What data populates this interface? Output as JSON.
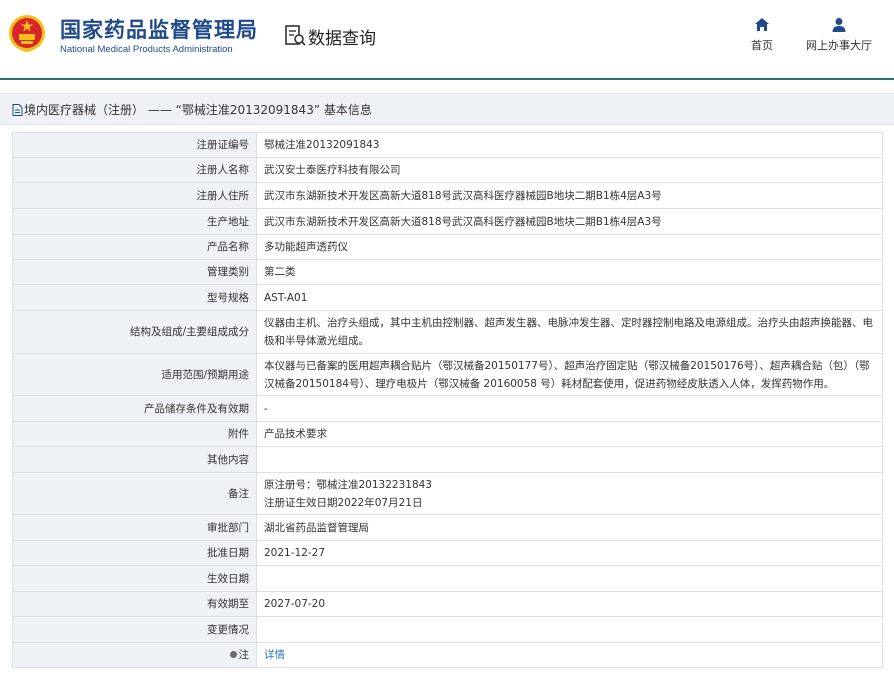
{
  "header": {
    "logo_cn": "国家药品监督管理局",
    "logo_en": "National Medical Products Administration",
    "site_title": "数据查询",
    "nav": [
      {
        "label": "首页",
        "icon": "home-icon"
      },
      {
        "label": "网上办事大厅",
        "icon": "person-icon"
      }
    ]
  },
  "breadcrumb": "境内医疗器械（注册） —— “鄂械注准20132091843” 基本信息",
  "colors": {
    "brand": "#1e4a8c",
    "header_line": "#2a6f7a",
    "label_bg": "#eef1f5",
    "link": "#3a78c2",
    "emblem_red": "#d8262c",
    "emblem_gold": "#f3c018"
  },
  "rows": [
    {
      "label": "注册证编号",
      "value": "鄂械注准20132091843"
    },
    {
      "label": "注册人名称",
      "value": "武汉安士泰医疗科技有限公司"
    },
    {
      "label": "注册人住所",
      "value": "武汉市东湖新技术开发区高新大道818号武汉高科医疗器械园B地块二期B1栋4层A3号"
    },
    {
      "label": "生产地址",
      "value": "武汉市东湖新技术开发区高新大道818号武汉高科医疗器械园B地块二期B1栋4层A3号"
    },
    {
      "label": "产品名称",
      "value": "多功能超声透药仪"
    },
    {
      "label": "管理类别",
      "value": "第二类"
    },
    {
      "label": "型号规格",
      "value": "AST-A01"
    },
    {
      "label": "结构及组成/主要组成成分",
      "value": "仪器由主机、治疗头组成，其中主机由控制器、超声发生器、电脉冲发生器、定时器控制电路及电源组成。治疗头由超声换能器、电极和半导体激光组成。"
    },
    {
      "label": "适用范围/预期用途",
      "value": "本仪器与已备案的医用超声耦合贴片（鄂汉械备20150177号）、超声治疗固定贴（鄂汉械备20150176号）、超声耦合贴（包）（鄂汉械备20150184号）、理疗电极片（鄂汉械备 20160058 号）耗材配套使用，促进药物经皮肤透入人体，发挥药物作用。"
    },
    {
      "label": "产品储存条件及有效期",
      "value": "-"
    },
    {
      "label": "附件",
      "value": "产品技术要求"
    },
    {
      "label": "其他内容",
      "value": ""
    },
    {
      "label": "备注",
      "value_lines": [
        "原注册号：鄂械注准20132231843",
        "注册证生效日期2022年07月21日"
      ]
    },
    {
      "label": "审批部门",
      "value": "湖北省药品监督管理局"
    },
    {
      "label": "批准日期",
      "value": "2021-12-27"
    },
    {
      "label": "生效日期",
      "value": ""
    },
    {
      "label": "有效期至",
      "value": "2027-07-20"
    },
    {
      "label": "变更情况",
      "value": ""
    },
    {
      "label": "注",
      "value": "详情",
      "link": true
    }
  ]
}
